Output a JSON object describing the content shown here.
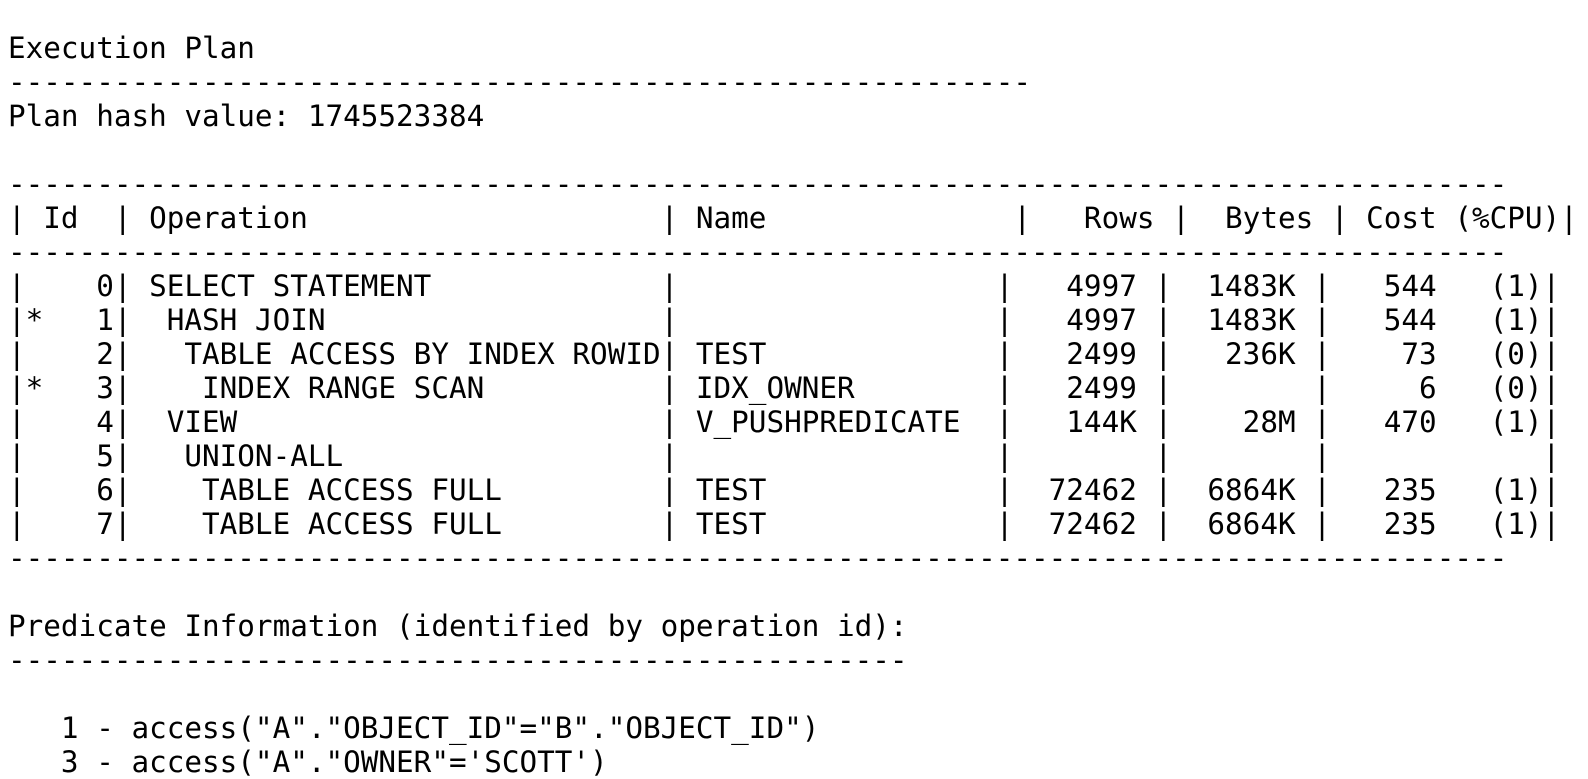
{
  "document": {
    "title": "Execution Plan",
    "title_underline_length": 58,
    "plan_hash_label": "Plan hash value:",
    "plan_hash_value": "1745523384",
    "border_length": 85,
    "predicate_header": "Predicate Information (identified by operation id):",
    "predicate_underline_length": 51
  },
  "table": {
    "columns": [
      {
        "name": "id",
        "header": "Id",
        "width": 5,
        "align": "right"
      },
      {
        "name": "operation",
        "header": "Operation",
        "width": 30,
        "align": "left"
      },
      {
        "name": "name",
        "header": "Name",
        "width": 18,
        "align": "left"
      },
      {
        "name": "rows",
        "header": "Rows",
        "width": 8,
        "align": "right"
      },
      {
        "name": "bytes",
        "header": "Bytes",
        "width": 8,
        "align": "right"
      },
      {
        "name": "cost",
        "header": "Cost (%CPU)",
        "width": 12,
        "align": "right"
      }
    ],
    "rows": [
      {
        "star": false,
        "id": "0",
        "indent": 0,
        "operation": "SELECT STATEMENT",
        "name": "",
        "rows": "4997",
        "bytes": "1483K",
        "cost": "544",
        "cpu": "(1)"
      },
      {
        "star": true,
        "id": "1",
        "indent": 1,
        "operation": "HASH JOIN",
        "name": "",
        "rows": "4997",
        "bytes": "1483K",
        "cost": "544",
        "cpu": "(1)"
      },
      {
        "star": false,
        "id": "2",
        "indent": 2,
        "operation": "TABLE ACCESS BY INDEX ROWID",
        "name": "TEST",
        "rows": "2499",
        "bytes": "236K",
        "cost": "73",
        "cpu": "(0)"
      },
      {
        "star": true,
        "id": "3",
        "indent": 3,
        "operation": "INDEX RANGE SCAN",
        "name": "IDX_OWNER",
        "rows": "2499",
        "bytes": "",
        "cost": "6",
        "cpu": "(0)"
      },
      {
        "star": false,
        "id": "4",
        "indent": 1,
        "operation": "VIEW",
        "name": "V_PUSHPREDICATE",
        "rows": "144K",
        "bytes": "28M",
        "cost": "470",
        "cpu": "(1)"
      },
      {
        "star": false,
        "id": "5",
        "indent": 2,
        "operation": "UNION-ALL",
        "name": "",
        "rows": "",
        "bytes": "",
        "cost": "",
        "cpu": ""
      },
      {
        "star": false,
        "id": "6",
        "indent": 3,
        "operation": "TABLE ACCESS FULL",
        "name": "TEST",
        "rows": "72462",
        "bytes": "6864K",
        "cost": "235",
        "cpu": "(1)"
      },
      {
        "star": false,
        "id": "7",
        "indent": 3,
        "operation": "TABLE ACCESS FULL",
        "name": "TEST",
        "rows": "72462",
        "bytes": "6864K",
        "cost": "235",
        "cpu": "(1)"
      }
    ]
  },
  "predicates": [
    {
      "id": "1",
      "text": "access(\"A\".\"OBJECT_ID\"=\"B\".\"OBJECT_ID\")"
    },
    {
      "id": "3",
      "text": "access(\"A\".\"OWNER\"='SCOTT')"
    }
  ],
  "colors": {
    "text": "#000000",
    "background": "#ffffff"
  }
}
